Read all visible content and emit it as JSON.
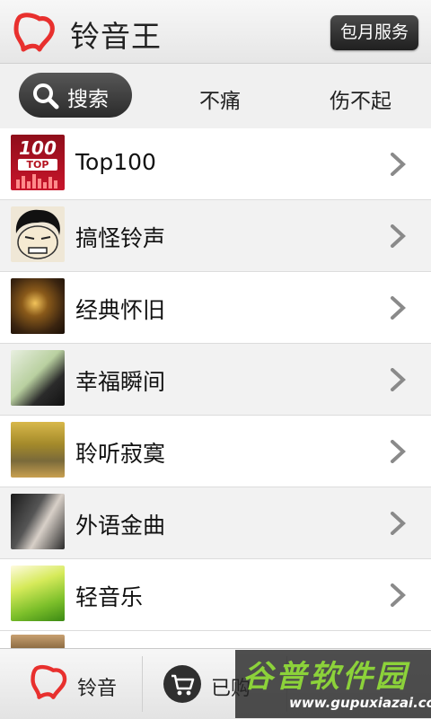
{
  "header": {
    "title": "铃音王",
    "service_button": "包月服务",
    "logo_icon": "bell-logo-icon"
  },
  "tabs": {
    "search_label": "搜索",
    "tab1": "不痛",
    "tab2": "伤不起"
  },
  "list": {
    "items": [
      {
        "label": "Top100",
        "thumb_text": "100",
        "thumb_sub": "TOP"
      },
      {
        "label": "搞怪铃声"
      },
      {
        "label": "经典怀旧"
      },
      {
        "label": "幸福瞬间"
      },
      {
        "label": "聆听寂寞"
      },
      {
        "label": "外语金曲"
      },
      {
        "label": "轻音乐"
      }
    ]
  },
  "bottom_nav": {
    "ringtone_label": "铃音",
    "purchased_label": "已购"
  },
  "watermark": {
    "title": "谷普软件园",
    "url": "www.gupuxiazai.com"
  },
  "colors": {
    "brand_red": "#e8302e",
    "watermark_green": "#8cd23a"
  }
}
